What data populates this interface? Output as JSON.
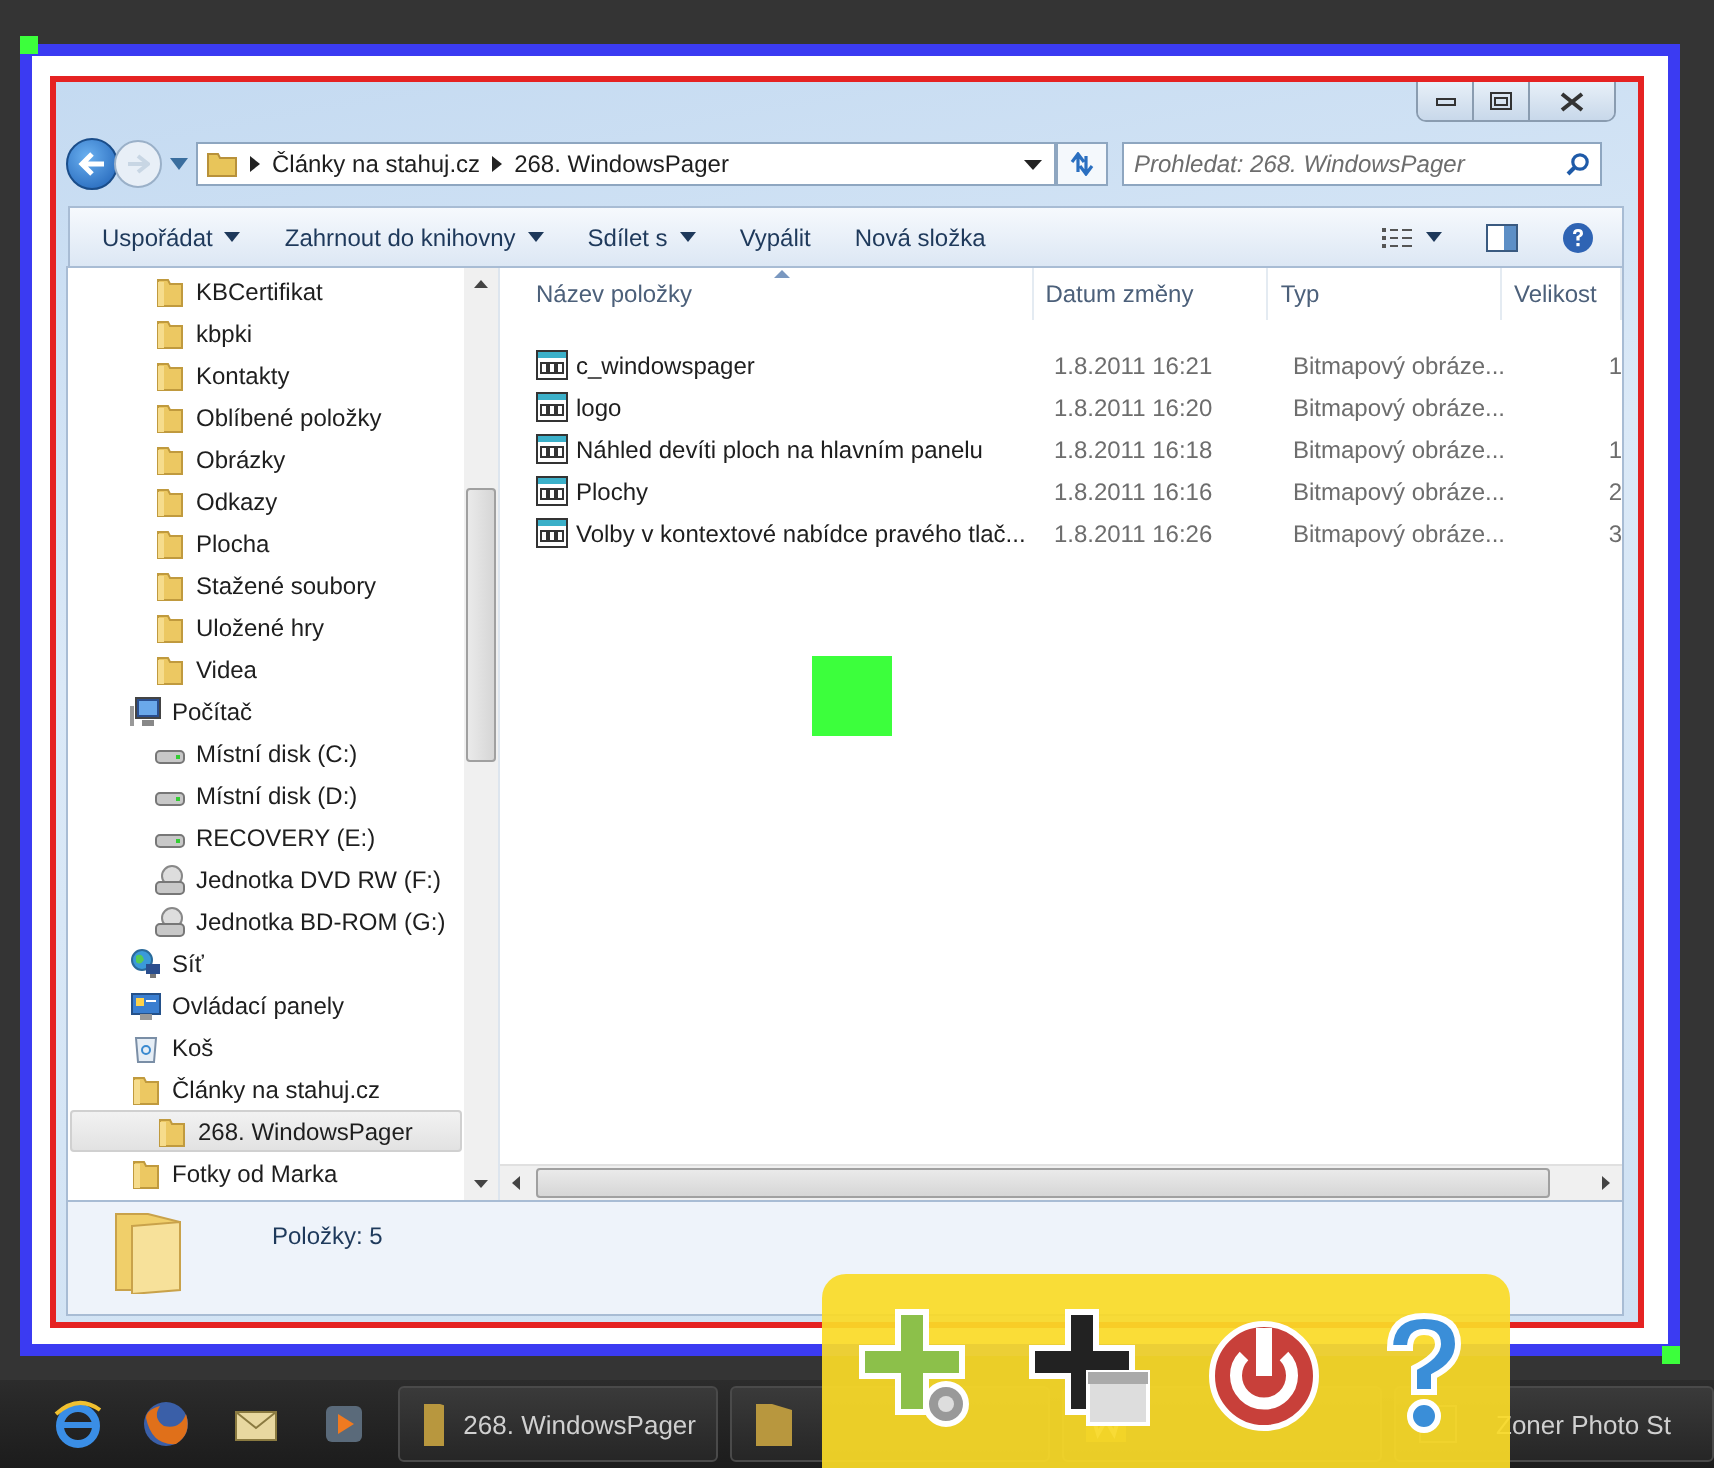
{
  "address": {
    "crumbs": [
      "Články na stahuj.cz",
      "268. WindowsPager"
    ]
  },
  "search": {
    "placeholder": "Prohledat: 268. WindowsPager"
  },
  "toolbar": [
    {
      "label": "Uspořádat",
      "menu": true
    },
    {
      "label": "Zahrnout do knihovny",
      "menu": true
    },
    {
      "label": "Sdílet s",
      "menu": true
    },
    {
      "label": "Vypálit",
      "menu": false
    },
    {
      "label": "Nová složka",
      "menu": false
    }
  ],
  "nav": {
    "items": [
      {
        "children": [
          {
            "label": "KBCertifikat",
            "kind": "folder",
            "selected": false
          },
          {
            "label": "kbpki",
            "kind": "folder",
            "selected": false
          },
          {
            "label": "Kontakty",
            "kind": "folder",
            "selected": false
          },
          {
            "label": "Oblíbené položky",
            "kind": "folder",
            "selected": false
          },
          {
            "label": "Obrázky",
            "kind": "folder",
            "selected": false
          },
          {
            "label": "Odkazy",
            "kind": "folder",
            "selected": false
          },
          {
            "label": "Plocha",
            "kind": "folder",
            "selected": false
          },
          {
            "label": "Stažené soubory",
            "kind": "folder",
            "selected": false
          },
          {
            "label": "Uložené hry",
            "kind": "folder",
            "selected": false
          },
          {
            "label": "Videa",
            "kind": "folder",
            "selected": false
          }
        ]
      },
      {
        "label": "Počítač",
        "kind": "computer",
        "selected": false,
        "children": [
          {
            "label": "Místní disk (C:)",
            "kind": "drive",
            "selected": false
          },
          {
            "label": "Místní disk (D:)",
            "kind": "drive",
            "selected": false
          },
          {
            "label": "RECOVERY (E:)",
            "kind": "drive",
            "selected": false
          },
          {
            "label": "Jednotka DVD RW (F:)",
            "kind": "disc",
            "selected": false
          },
          {
            "label": "Jednotka BD-ROM (G:)",
            "kind": "disc",
            "selected": false
          }
        ]
      },
      {
        "label": "Síť",
        "kind": "network",
        "selected": false
      },
      {
        "label": "Ovládací panely",
        "kind": "control",
        "selected": false
      },
      {
        "label": "Koš",
        "kind": "bin",
        "selected": false
      },
      {
        "label": "Články na stahuj.cz",
        "kind": "folder",
        "selected": false,
        "children": [
          {
            "label": "268. WindowsPager",
            "kind": "folder",
            "selected": true
          }
        ]
      },
      {
        "label": "Fotky od Marka",
        "kind": "folder",
        "selected": false
      }
    ]
  },
  "table": {
    "columns": [
      "Název položky",
      "Datum změny",
      "Typ",
      "Velikost"
    ],
    "rows": [
      {
        "name": "c_windowspager",
        "date": "1.8.2011 16:21",
        "type": "Bitmapový obráze...",
        "size": "1"
      },
      {
        "name": "logo",
        "date": "1.8.2011 16:20",
        "type": "Bitmapový obráze..."
      },
      {
        "name": "Náhled devíti ploch na hlavním panelu",
        "date": "1.8.2011 16:18",
        "type": "Bitmapový obráze...",
        "size": "1"
      },
      {
        "name": "Plochy",
        "date": "1.8.2011 16:16",
        "type": "Bitmapový obráze...",
        "size": "2"
      },
      {
        "name": "Volby v kontextové nabídce pravého tlač...",
        "date": "1.8.2011 16:26",
        "type": "Bitmapový obráze...",
        "size": "3"
      }
    ]
  },
  "status_bar": {
    "text": "Položky: 5"
  },
  "taskbar": {
    "buttons": [
      {
        "label": "268. WindowsPager",
        "kind": "folder"
      },
      {
        "kind": "folder"
      },
      {
        "kind": "word"
      },
      {
        "label": "Zoner Photo St",
        "kind": "photo"
      }
    ]
  }
}
